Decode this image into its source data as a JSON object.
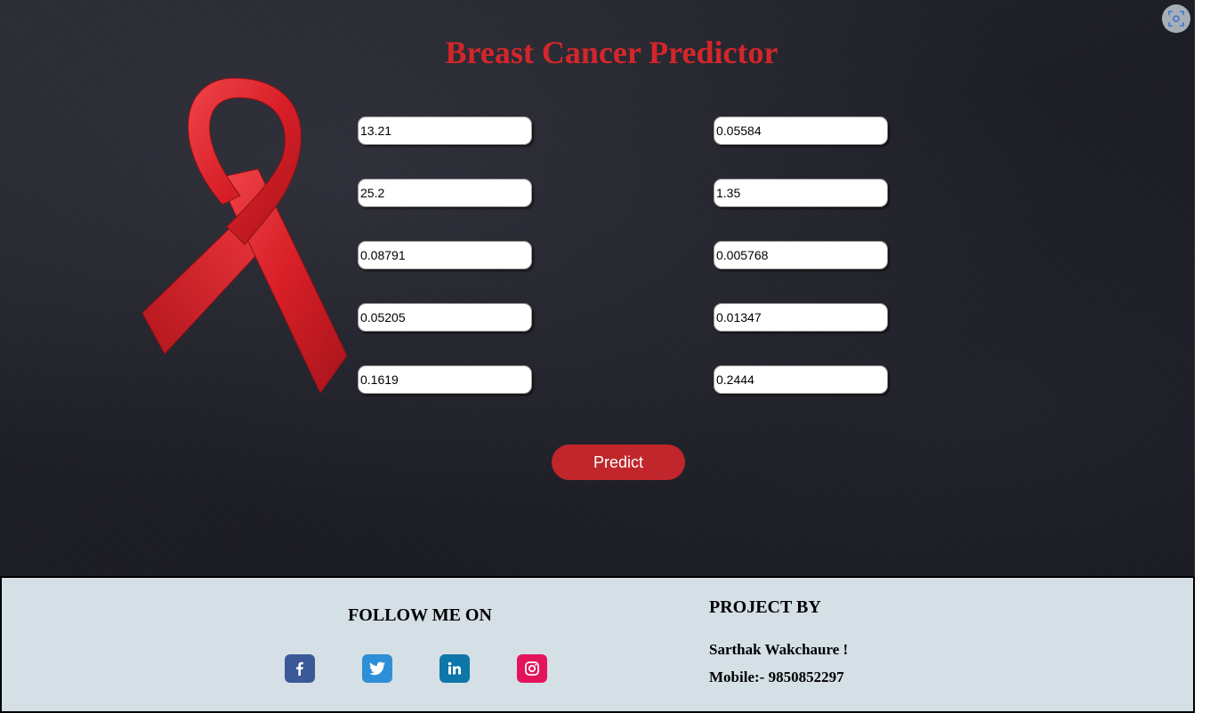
{
  "header": {
    "title": "Breast Cancer Predictor"
  },
  "form": {
    "left_fields": [
      "13.21",
      "25.2",
      "0.08791",
      "0.05205",
      "0.1619"
    ],
    "right_fields": [
      "0.05584",
      "1.35",
      "0.005768",
      "0.01347",
      "0.2444"
    ],
    "predict_label": "Predict"
  },
  "footer": {
    "follow_title": "FOLLOW ME ON",
    "social": [
      {
        "name": "facebook-icon",
        "color": "#3b5998"
      },
      {
        "name": "twitter-icon",
        "color": "#2d8fd5"
      },
      {
        "name": "linkedin-icon",
        "color": "#0e76a8"
      },
      {
        "name": "instagram-icon",
        "color": "#e4145c"
      }
    ],
    "project_title": "PROJECT BY",
    "author": "Sarthak Wakchaure !",
    "mobile": "Mobile:- 9850852297"
  },
  "colors": {
    "title": "#d3262a",
    "button": "#c0262b",
    "footer_bg": "#d5dfe6",
    "hero_bg": "#1d1d25"
  },
  "icons": {
    "corner": "screen-capture-icon",
    "ribbon": "awareness-ribbon-icon"
  }
}
